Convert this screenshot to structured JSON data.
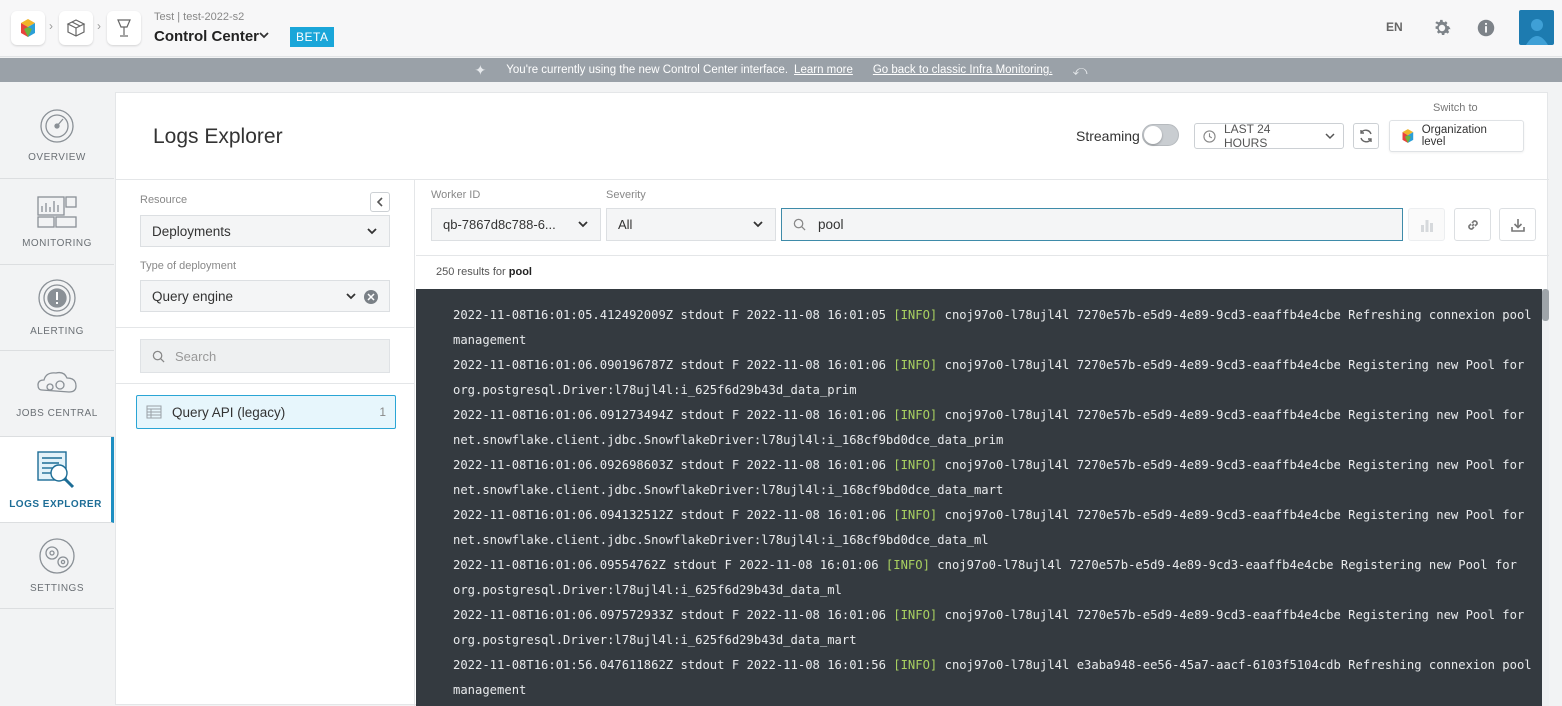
{
  "topbar": {
    "project_sub": "Test | test-2022-s2",
    "title": "Control Center",
    "beta_label": "BETA",
    "lang": "EN"
  },
  "banner": {
    "message": "You're currently using the new Control Center interface.",
    "learn_more": "Learn more",
    "back_link": "Go back to classic Infra Monitoring."
  },
  "sidebar": {
    "items": [
      {
        "label": "OVERVIEW",
        "icon": "gauge-icon"
      },
      {
        "label": "MONITORING",
        "icon": "monitor-icon"
      },
      {
        "label": "ALERTING",
        "icon": "alert-icon"
      },
      {
        "label": "JOBS CENTRAL",
        "icon": "jobs-icon"
      },
      {
        "label": "LOGS EXPLORER",
        "icon": "logs-icon",
        "active": true
      },
      {
        "label": "SETTINGS",
        "icon": "gear-icon"
      }
    ]
  },
  "header": {
    "title": "Logs Explorer",
    "streaming_label": "Streaming",
    "streaming_on": false,
    "range_label": "LAST 24 HOURS",
    "switch_to": "Switch to",
    "org_level": "Organization level"
  },
  "filters": {
    "resource_label": "Resource",
    "resource_value": "Deployments",
    "deployment_type_label": "Type of deployment",
    "deployment_type_value": "Query engine",
    "search_placeholder": "Search",
    "items": [
      {
        "name": "Query API (legacy)",
        "count": "1"
      }
    ]
  },
  "query_bar": {
    "worker_label": "Worker ID",
    "worker_value": "qb-7867d8c788-6...",
    "severity_label": "Severity",
    "severity_value": "All",
    "query": "pool"
  },
  "results": {
    "count_text": "250 results for",
    "term": "pool"
  },
  "logs": [
    {
      "pre": "2022-11-08T16:01:05.412492009Z stdout F 2022-11-08 16:01:05 ",
      "level": "[INFO]",
      "post": " cnoj97o0-l78ujl4l 7270e57b-e5d9-4e89-9cd3-eaaffb4e4cbe Refreshing connexion pool"
    },
    {
      "pre": "management",
      "level": "",
      "post": ""
    },
    {
      "pre": "2022-11-08T16:01:06.090196787Z stdout F 2022-11-08 16:01:06 ",
      "level": "[INFO]",
      "post": " cnoj97o0-l78ujl4l 7270e57b-e5d9-4e89-9cd3-eaaffb4e4cbe Registering new Pool for"
    },
    {
      "pre": "org.postgresql.Driver:l78ujl4l:i_625f6d29b43d_data_prim",
      "level": "",
      "post": ""
    },
    {
      "pre": "2022-11-08T16:01:06.091273494Z stdout F 2022-11-08 16:01:06 ",
      "level": "[INFO]",
      "post": " cnoj97o0-l78ujl4l 7270e57b-e5d9-4e89-9cd3-eaaffb4e4cbe Registering new Pool for"
    },
    {
      "pre": "net.snowflake.client.jdbc.SnowflakeDriver:l78ujl4l:i_168cf9bd0dce_data_prim",
      "level": "",
      "post": ""
    },
    {
      "pre": "2022-11-08T16:01:06.092698603Z stdout F 2022-11-08 16:01:06 ",
      "level": "[INFO]",
      "post": " cnoj97o0-l78ujl4l 7270e57b-e5d9-4e89-9cd3-eaaffb4e4cbe Registering new Pool for"
    },
    {
      "pre": "net.snowflake.client.jdbc.SnowflakeDriver:l78ujl4l:i_168cf9bd0dce_data_mart",
      "level": "",
      "post": ""
    },
    {
      "pre": "2022-11-08T16:01:06.094132512Z stdout F 2022-11-08 16:01:06 ",
      "level": "[INFO]",
      "post": " cnoj97o0-l78ujl4l 7270e57b-e5d9-4e89-9cd3-eaaffb4e4cbe Registering new Pool for"
    },
    {
      "pre": "net.snowflake.client.jdbc.SnowflakeDriver:l78ujl4l:i_168cf9bd0dce_data_ml",
      "level": "",
      "post": ""
    },
    {
      "pre": "2022-11-08T16:01:06.09554762Z stdout F 2022-11-08 16:01:06 ",
      "level": "[INFO]",
      "post": " cnoj97o0-l78ujl4l 7270e57b-e5d9-4e89-9cd3-eaaffb4e4cbe Registering new Pool for"
    },
    {
      "pre": "org.postgresql.Driver:l78ujl4l:i_625f6d29b43d_data_ml",
      "level": "",
      "post": ""
    },
    {
      "pre": "2022-11-08T16:01:06.097572933Z stdout F 2022-11-08 16:01:06 ",
      "level": "[INFO]",
      "post": " cnoj97o0-l78ujl4l 7270e57b-e5d9-4e89-9cd3-eaaffb4e4cbe Registering new Pool for"
    },
    {
      "pre": "org.postgresql.Driver:l78ujl4l:i_625f6d29b43d_data_mart",
      "level": "",
      "post": ""
    },
    {
      "pre": "2022-11-08T16:01:56.047611862Z stdout F 2022-11-08 16:01:56 ",
      "level": "[INFO]",
      "post": " cnoj97o0-l78ujl4l e3aba948-ee56-45a7-aacf-6103f5104cdb Refreshing connexion pool"
    },
    {
      "pre": "management",
      "level": "",
      "post": ""
    }
  ],
  "colors": {
    "accent": "#1aa6d9",
    "active_border": "#1d8ec2",
    "log_bg": "#343a40",
    "log_info": "#a9d160"
  }
}
